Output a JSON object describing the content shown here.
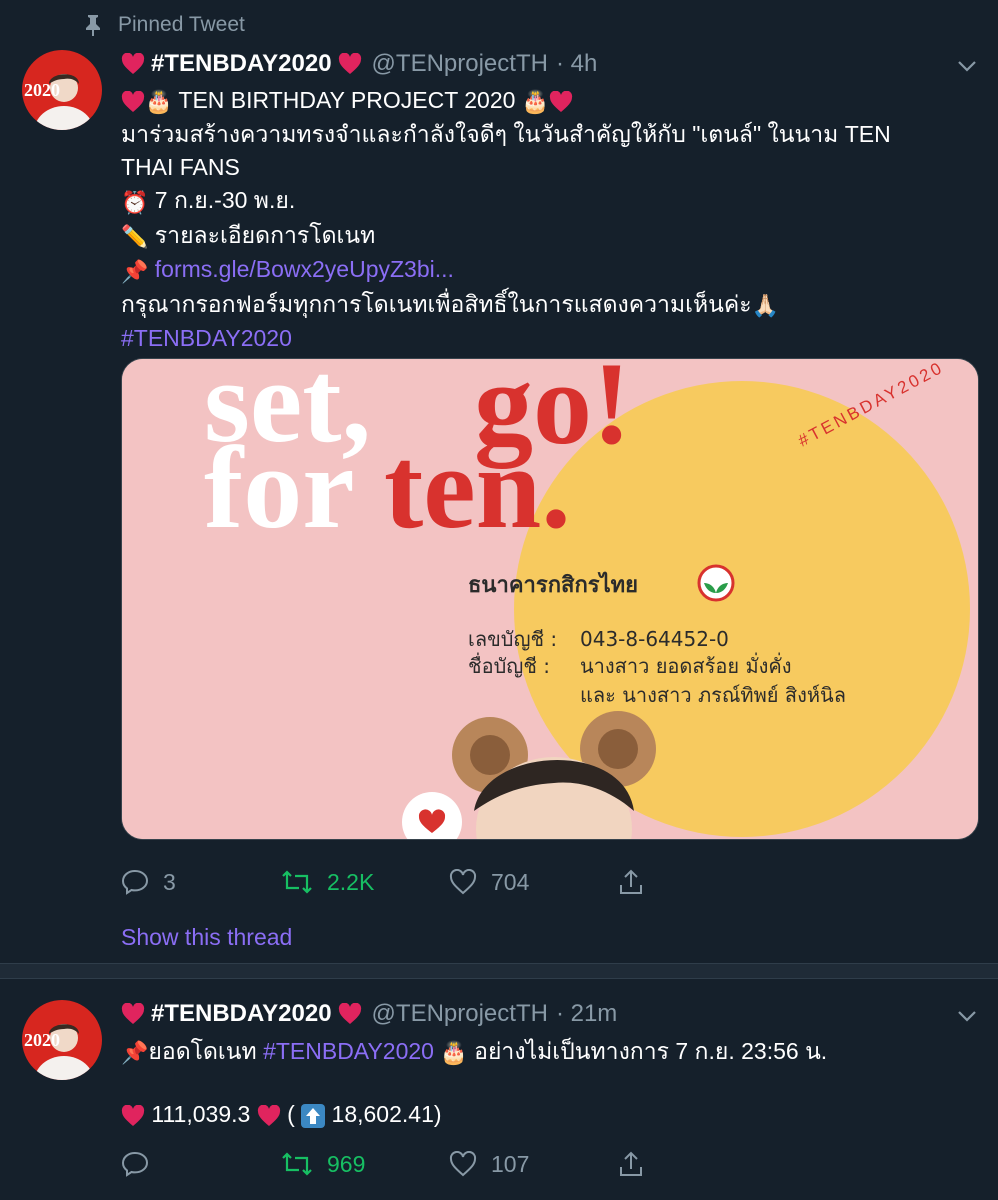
{
  "pinned_label": "Pinned Tweet",
  "tweet1": {
    "name": "#TENBDAY2020",
    "handle": "@TENprojectTH",
    "time": "· 4h",
    "line1": "TEN BIRTHDAY PROJECT 2020",
    "line2": "มาร่วมสร้างความทรงจำและกำลังใจดีๆ ในวันสำคัญให้กับ \"เตนล์\" ในนาม TEN",
    "line3": "THAI FANS",
    "line4": "7 ก.ย.-30 พ.ย.",
    "line5": "รายละเอียดการโดเนท",
    "link": "forms.gle/Bowx2yeUpyZ3bi...",
    "line7": "กรุณากรอกฟอร์มทุกการโดเนทเพื่อสิทธิ์ในการแสดงความเห็นค่ะ",
    "hashtag": "#TENBDAY2020",
    "replies": "3",
    "retweets": "2.2K",
    "likes": "704",
    "show_thread": "Show this thread"
  },
  "card": {
    "word_set": "set,",
    "word_go": "go!",
    "word_for": "for",
    "word_ten": "ten.",
    "circle_tag": "#TENBDAY2020",
    "bank_name": "ธนาคารกสิกรไทย",
    "acct_label": "เลขบัญชี :",
    "acct_number": "043-8-64452-0",
    "acct_name_label": "ชื่อบัญชี :",
    "acct_name1": "นางสาว ยอดสร้อย มั่งคั่ง",
    "acct_name2": "และ นางสาว ภรณ์ทิพย์ สิงห์นิล"
  },
  "tweet2": {
    "name": "#TENBDAY2020",
    "handle": "@TENprojectTH",
    "time": "· 21m",
    "text_a": "ยอดโดเนท",
    "hashtag": "#TENBDAY2020",
    "text_b": "อย่างไม่เป็นทางการ  7 ก.ย. 23:56 น.",
    "total": "111,039.3",
    "paren_open": "(",
    "increase": "18,602.41)",
    "replies": "",
    "retweets": "969",
    "likes": "107"
  },
  "avatar_text": "2020",
  "colors": {
    "bg": "#15202b",
    "muted": "#8899a6",
    "link": "#8b6ef5",
    "retweet": "#17bf63",
    "heart": "#e0245e"
  },
  "icons": [
    "pin-icon",
    "heart-icon",
    "cake-icon",
    "alarm-clock-icon",
    "pencil-icon",
    "pushpin-icon",
    "folded-hands-icon",
    "chevron-down-icon",
    "reply-icon",
    "retweet-icon",
    "like-icon",
    "share-icon",
    "up-arrow-icon"
  ]
}
